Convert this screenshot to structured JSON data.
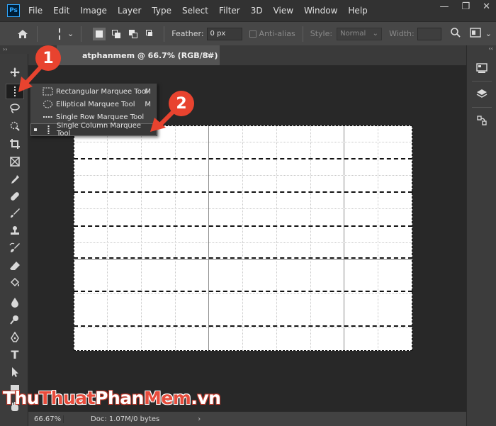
{
  "app": {
    "logo": "Ps"
  },
  "menu": [
    "File",
    "Edit",
    "Image",
    "Layer",
    "Type",
    "Select",
    "Filter",
    "3D",
    "View",
    "Window",
    "Help"
  ],
  "window_controls": {
    "minimize": "—",
    "restore": "❐",
    "close": "✕"
  },
  "options": {
    "feather_label": "Feather:",
    "feather_value": "0 px",
    "antialias_label": "Anti-alias",
    "style_label": "Style:",
    "style_value": "Normal",
    "width_label": "Width:"
  },
  "document": {
    "tab_title": "atphanmem @ 66.7% (RGB/8#)",
    "close": "✕"
  },
  "flyout": {
    "items": [
      {
        "label": "Rectangular Marquee Tool",
        "shortcut": "M"
      },
      {
        "label": "Elliptical Marquee Tool",
        "shortcut": "M"
      },
      {
        "label": "Single Row Marquee Tool",
        "shortcut": ""
      },
      {
        "label": "Single Column Marquee Tool",
        "shortcut": ""
      }
    ]
  },
  "status": {
    "zoom": "66.67%",
    "doc": "Doc: 1.07M/0 bytes",
    "arrow": "›"
  },
  "callouts": {
    "one": "1",
    "two": "2"
  },
  "watermark": {
    "part1": "Thu",
    "part2": "Thuat",
    "part3": "Phan",
    "part4": "Mem",
    "part5": ".vn"
  },
  "colors": {
    "callout": "#e8432f",
    "menubar": "#323232",
    "panel": "#3c3c3c",
    "canvas_bg": "#282828"
  }
}
